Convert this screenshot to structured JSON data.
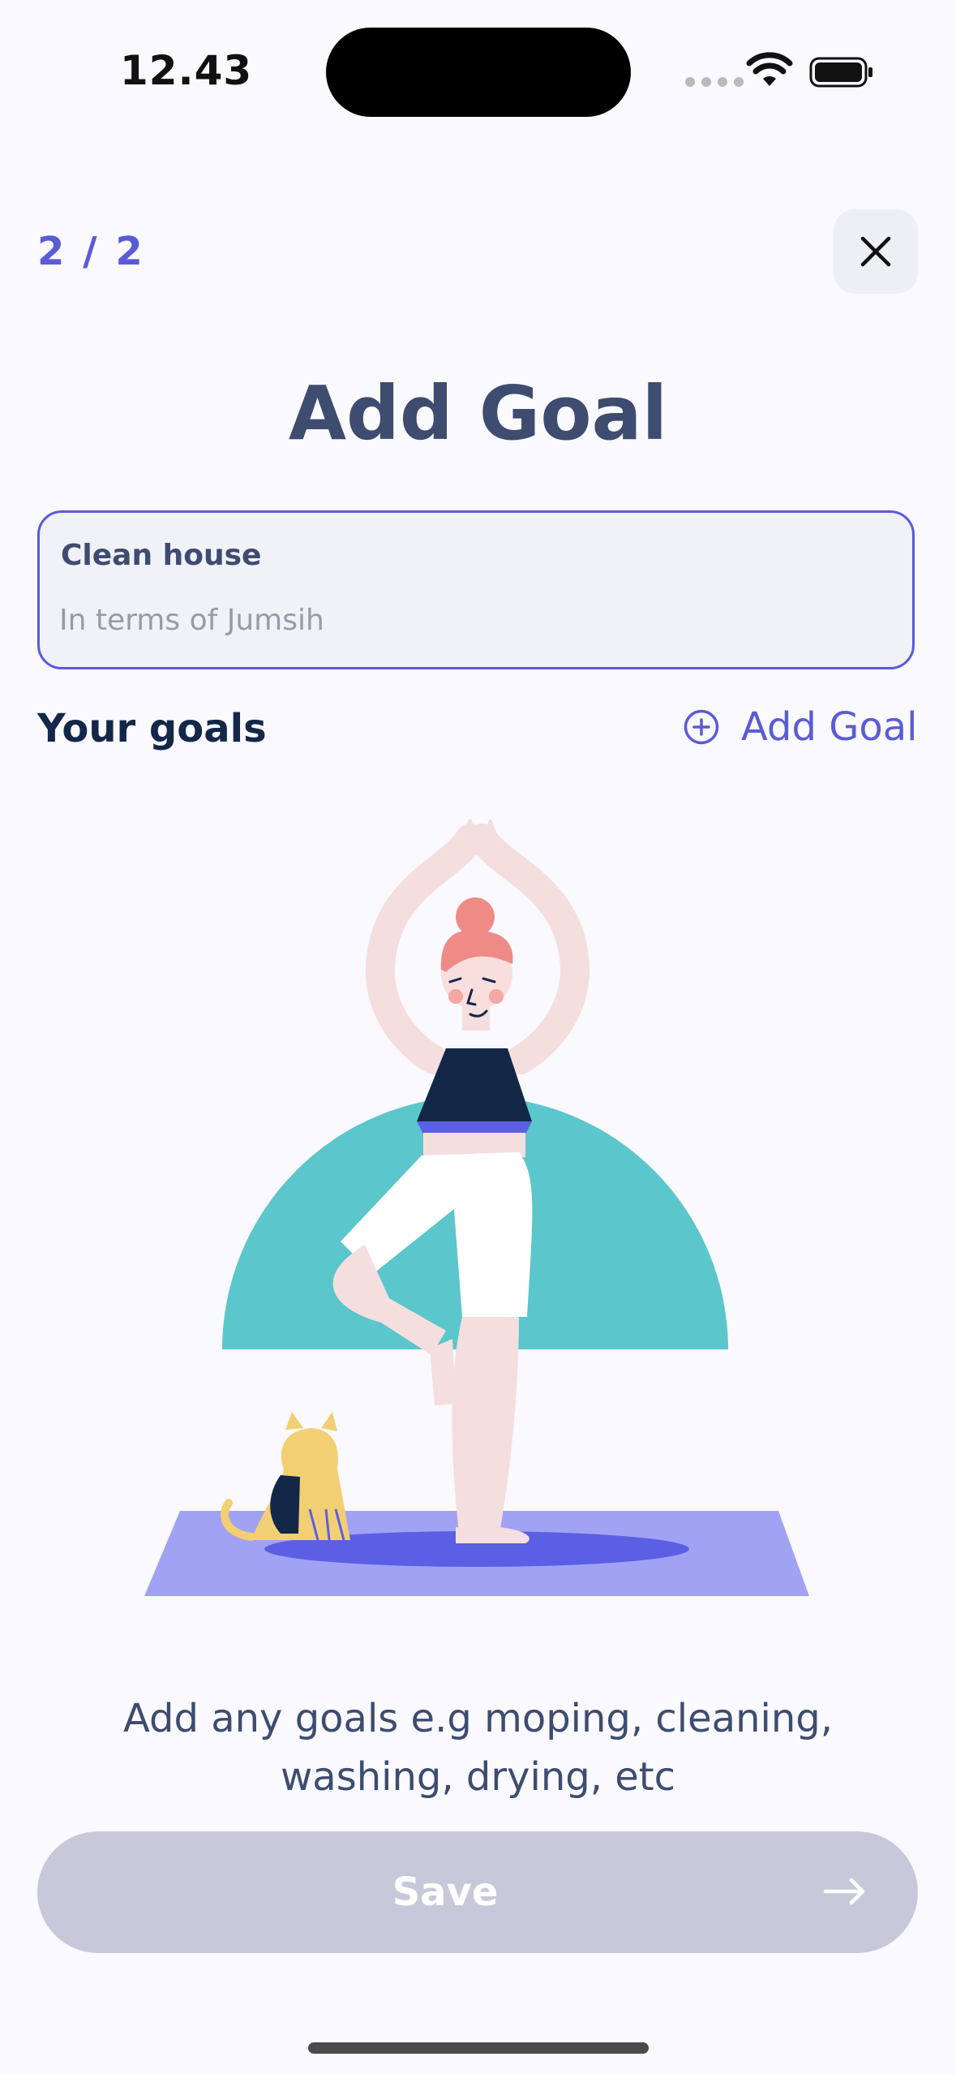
{
  "status_bar": {
    "time": "12.43",
    "icons": [
      "signal-icon",
      "wifi-icon",
      "battery-icon"
    ]
  },
  "header": {
    "step": "2 / 2",
    "close_icon": "close-icon",
    "title": "Add Goal"
  },
  "goal_input": {
    "label": "Clean house",
    "value": "",
    "placeholder": "In terms of Jumsih"
  },
  "goals_section": {
    "heading": "Your goals",
    "add_icon": "plus-circle-icon",
    "add_label": "Add Goal"
  },
  "illustration": {
    "name": "woman-yoga-tree-pose-with-cat-illustration"
  },
  "empty_hint": {
    "line1": "Add any goals e.g moping, cleaning,",
    "line2": "washing, drying, etc"
  },
  "footer": {
    "save_label": "Save",
    "arrow_icon": "arrow-right-icon"
  },
  "colors": {
    "accent": "#5b5bd6",
    "title": "#3d4c6f",
    "heading": "#132749",
    "button_disabled": "#c8c8da",
    "background": "#f9f9fe",
    "teal": "#5bc6cc",
    "mat": "#a0a2f4"
  }
}
